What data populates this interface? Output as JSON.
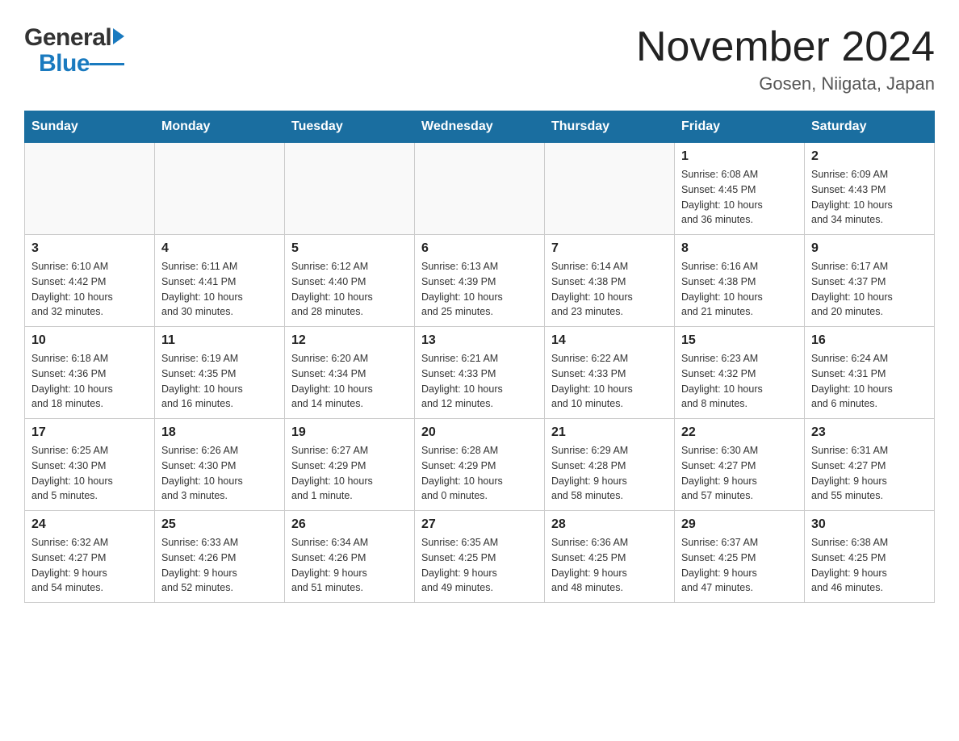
{
  "header": {
    "logo_general": "General",
    "logo_blue": "Blue",
    "month_year": "November 2024",
    "location": "Gosen, Niigata, Japan"
  },
  "weekdays": [
    "Sunday",
    "Monday",
    "Tuesday",
    "Wednesday",
    "Thursday",
    "Friday",
    "Saturday"
  ],
  "weeks": [
    [
      {
        "day": "",
        "info": ""
      },
      {
        "day": "",
        "info": ""
      },
      {
        "day": "",
        "info": ""
      },
      {
        "day": "",
        "info": ""
      },
      {
        "day": "",
        "info": ""
      },
      {
        "day": "1",
        "info": "Sunrise: 6:08 AM\nSunset: 4:45 PM\nDaylight: 10 hours\nand 36 minutes."
      },
      {
        "day": "2",
        "info": "Sunrise: 6:09 AM\nSunset: 4:43 PM\nDaylight: 10 hours\nand 34 minutes."
      }
    ],
    [
      {
        "day": "3",
        "info": "Sunrise: 6:10 AM\nSunset: 4:42 PM\nDaylight: 10 hours\nand 32 minutes."
      },
      {
        "day": "4",
        "info": "Sunrise: 6:11 AM\nSunset: 4:41 PM\nDaylight: 10 hours\nand 30 minutes."
      },
      {
        "day": "5",
        "info": "Sunrise: 6:12 AM\nSunset: 4:40 PM\nDaylight: 10 hours\nand 28 minutes."
      },
      {
        "day": "6",
        "info": "Sunrise: 6:13 AM\nSunset: 4:39 PM\nDaylight: 10 hours\nand 25 minutes."
      },
      {
        "day": "7",
        "info": "Sunrise: 6:14 AM\nSunset: 4:38 PM\nDaylight: 10 hours\nand 23 minutes."
      },
      {
        "day": "8",
        "info": "Sunrise: 6:16 AM\nSunset: 4:38 PM\nDaylight: 10 hours\nand 21 minutes."
      },
      {
        "day": "9",
        "info": "Sunrise: 6:17 AM\nSunset: 4:37 PM\nDaylight: 10 hours\nand 20 minutes."
      }
    ],
    [
      {
        "day": "10",
        "info": "Sunrise: 6:18 AM\nSunset: 4:36 PM\nDaylight: 10 hours\nand 18 minutes."
      },
      {
        "day": "11",
        "info": "Sunrise: 6:19 AM\nSunset: 4:35 PM\nDaylight: 10 hours\nand 16 minutes."
      },
      {
        "day": "12",
        "info": "Sunrise: 6:20 AM\nSunset: 4:34 PM\nDaylight: 10 hours\nand 14 minutes."
      },
      {
        "day": "13",
        "info": "Sunrise: 6:21 AM\nSunset: 4:33 PM\nDaylight: 10 hours\nand 12 minutes."
      },
      {
        "day": "14",
        "info": "Sunrise: 6:22 AM\nSunset: 4:33 PM\nDaylight: 10 hours\nand 10 minutes."
      },
      {
        "day": "15",
        "info": "Sunrise: 6:23 AM\nSunset: 4:32 PM\nDaylight: 10 hours\nand 8 minutes."
      },
      {
        "day": "16",
        "info": "Sunrise: 6:24 AM\nSunset: 4:31 PM\nDaylight: 10 hours\nand 6 minutes."
      }
    ],
    [
      {
        "day": "17",
        "info": "Sunrise: 6:25 AM\nSunset: 4:30 PM\nDaylight: 10 hours\nand 5 minutes."
      },
      {
        "day": "18",
        "info": "Sunrise: 6:26 AM\nSunset: 4:30 PM\nDaylight: 10 hours\nand 3 minutes."
      },
      {
        "day": "19",
        "info": "Sunrise: 6:27 AM\nSunset: 4:29 PM\nDaylight: 10 hours\nand 1 minute."
      },
      {
        "day": "20",
        "info": "Sunrise: 6:28 AM\nSunset: 4:29 PM\nDaylight: 10 hours\nand 0 minutes."
      },
      {
        "day": "21",
        "info": "Sunrise: 6:29 AM\nSunset: 4:28 PM\nDaylight: 9 hours\nand 58 minutes."
      },
      {
        "day": "22",
        "info": "Sunrise: 6:30 AM\nSunset: 4:27 PM\nDaylight: 9 hours\nand 57 minutes."
      },
      {
        "day": "23",
        "info": "Sunrise: 6:31 AM\nSunset: 4:27 PM\nDaylight: 9 hours\nand 55 minutes."
      }
    ],
    [
      {
        "day": "24",
        "info": "Sunrise: 6:32 AM\nSunset: 4:27 PM\nDaylight: 9 hours\nand 54 minutes."
      },
      {
        "day": "25",
        "info": "Sunrise: 6:33 AM\nSunset: 4:26 PM\nDaylight: 9 hours\nand 52 minutes."
      },
      {
        "day": "26",
        "info": "Sunrise: 6:34 AM\nSunset: 4:26 PM\nDaylight: 9 hours\nand 51 minutes."
      },
      {
        "day": "27",
        "info": "Sunrise: 6:35 AM\nSunset: 4:25 PM\nDaylight: 9 hours\nand 49 minutes."
      },
      {
        "day": "28",
        "info": "Sunrise: 6:36 AM\nSunset: 4:25 PM\nDaylight: 9 hours\nand 48 minutes."
      },
      {
        "day": "29",
        "info": "Sunrise: 6:37 AM\nSunset: 4:25 PM\nDaylight: 9 hours\nand 47 minutes."
      },
      {
        "day": "30",
        "info": "Sunrise: 6:38 AM\nSunset: 4:25 PM\nDaylight: 9 hours\nand 46 minutes."
      }
    ]
  ]
}
